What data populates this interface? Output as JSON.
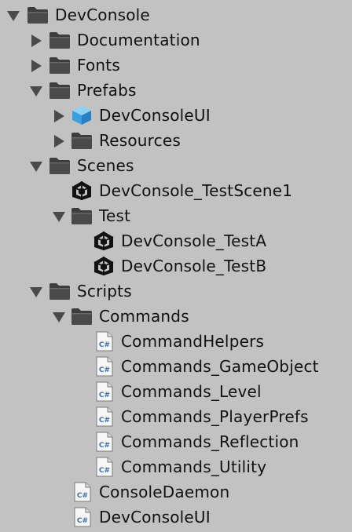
{
  "tree": {
    "devconsole": "DevConsole",
    "documentation": "Documentation",
    "fonts": "Fonts",
    "prefabs": "Prefabs",
    "devconsoleui_prefab": "DevConsoleUI",
    "resources": "Resources",
    "scenes": "Scenes",
    "testscene1": "DevConsole_TestScene1",
    "test": "Test",
    "testa": "DevConsole_TestA",
    "testb": "DevConsole_TestB",
    "scripts": "Scripts",
    "commands": "Commands",
    "command_helpers": "CommandHelpers",
    "commands_gameobject": "Commands_GameObject",
    "commands_level": "Commands_Level",
    "commands_playerprefs": "Commands_PlayerPrefs",
    "commands_reflection": "Commands_Reflection",
    "commands_utility": "Commands_Utility",
    "console_daemon": "ConsoleDaemon",
    "devconsoleui_script": "DevConsoleUI"
  },
  "icons": {
    "folder": "folder-icon",
    "prefab": "prefab-cube-icon",
    "scene": "unity-scene-icon",
    "script": "csharp-script-icon",
    "expanded": "triangle-down-icon",
    "collapsed": "triangle-right-icon"
  },
  "colors": {
    "background": "#c2c2c2",
    "folder": "#4a4a4a",
    "arrow": "#4a4a4a",
    "prefab": "#4aa8e8",
    "text": "#111111"
  },
  "script_glyph": "C#"
}
